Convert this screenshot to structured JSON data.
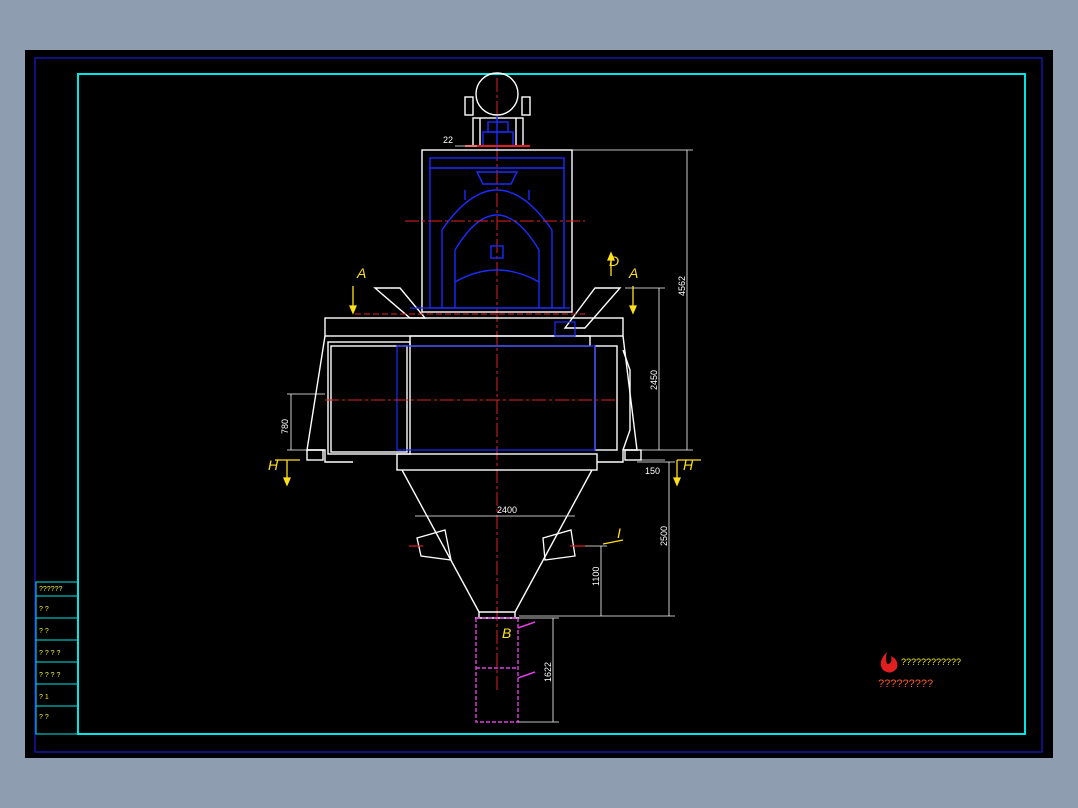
{
  "colors": {
    "background": "#000000",
    "frame_outer": "#1a1ad0",
    "frame_inner": "#00e5e5",
    "outline": "#ffffff",
    "hidden_blue": "#1a2cff",
    "centerline": "#e02020",
    "dimension": "#ffffff",
    "section_label": "#ffe01a",
    "port_magenta": "#e040e0"
  },
  "dimensions": {
    "d22": "22",
    "d4562": "4562",
    "d2450": "2450",
    "d780": "780",
    "d150": "150",
    "d2400": "2400",
    "d2500": "2500",
    "d1100": "1100",
    "d1622": "1622"
  },
  "section_labels": {
    "a_left": "A",
    "a_right": "A",
    "d_mark": "D",
    "h_left": "H",
    "h_right": "H",
    "b_mark": "B",
    "i_mark": "I"
  },
  "title_block": {
    "rows": [
      "??????",
      "?      ?",
      "?      ?",
      "? ? ? ?",
      "? ? ? ?",
      "?      1",
      "?      ?"
    ]
  },
  "logo": {
    "line1": "????????????",
    "line2": "?????????"
  }
}
